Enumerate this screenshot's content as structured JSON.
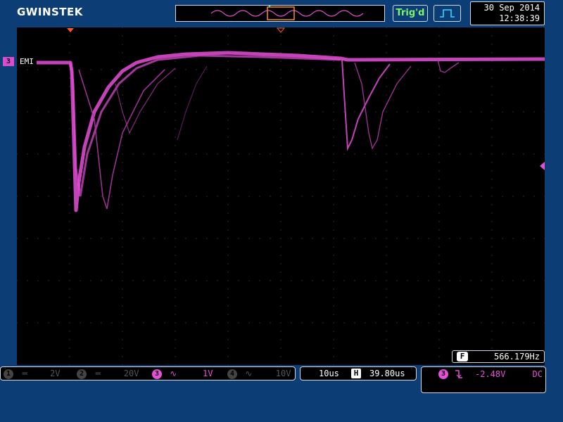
{
  "brand": {
    "name": "GWINSTEK"
  },
  "status": {
    "trigger_state": "Trig'd"
  },
  "datetime": {
    "date": "30 Sep 2014",
    "time": "12:38:39"
  },
  "channel3": {
    "marker": "3",
    "label": "EMI"
  },
  "frequency": {
    "icon": "F",
    "value": "566.179Hz"
  },
  "channels": [
    {
      "num": "1",
      "coupling": "DC",
      "scale": "2V",
      "active": false
    },
    {
      "num": "2",
      "coupling": "DC",
      "scale": "20V",
      "active": false
    },
    {
      "num": "3",
      "coupling": "AC",
      "scale": "1V",
      "active": true
    },
    {
      "num": "4",
      "coupling": "AC",
      "scale": "10V",
      "active": false
    }
  ],
  "timebase": {
    "scale": "10us",
    "delay_icon": "H",
    "delay": "39.80us"
  },
  "trigger": {
    "source": "3",
    "slope": "falling",
    "level": "-2.48V",
    "coupling": "DC"
  },
  "colors": {
    "trace": "#e64fd8",
    "grid": "#5a5a5a",
    "background": "#0c3d74",
    "trig_text": "#7ff36b"
  }
}
